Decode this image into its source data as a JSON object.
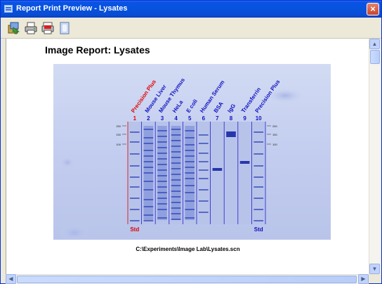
{
  "window": {
    "title": "Report Print Preview - Lysates",
    "close_label": "×"
  },
  "toolbar": {
    "buttons": [
      "export-icon",
      "print-icon",
      "pdf-icon",
      "page-icon"
    ]
  },
  "report": {
    "title": "Image Report: Lysates",
    "file_path": "C:\\Experiments\\Image Lab\\Lysates.scn"
  },
  "gel": {
    "lanes": [
      {
        "number": "1",
        "name": "Precision Plus",
        "color": "#e00000"
      },
      {
        "number": "2",
        "name": "Mouse Liver",
        "color": "#1010c0"
      },
      {
        "number": "3",
        "name": "Mouse Thymus",
        "color": "#1010c0"
      },
      {
        "number": "4",
        "name": "HeLa",
        "color": "#1010c0"
      },
      {
        "number": "5",
        "name": "E coli",
        "color": "#1010c0"
      },
      {
        "number": "6",
        "name": "Human Serum",
        "color": "#1010c0"
      },
      {
        "number": "7",
        "name": "BSA",
        "color": "#1010c0"
      },
      {
        "number": "8",
        "name": "IgG",
        "color": "#1010c0"
      },
      {
        "number": "9",
        "name": "Transferrin",
        "color": "#1010c0"
      },
      {
        "number": "10",
        "name": "Precision Plus",
        "color": "#1010c0"
      }
    ],
    "std_left": "Std",
    "std_right": "Std",
    "markers_left": [
      "250",
      "150",
      "100"
    ],
    "markers_right": [
      "250",
      "150",
      "100"
    ]
  }
}
